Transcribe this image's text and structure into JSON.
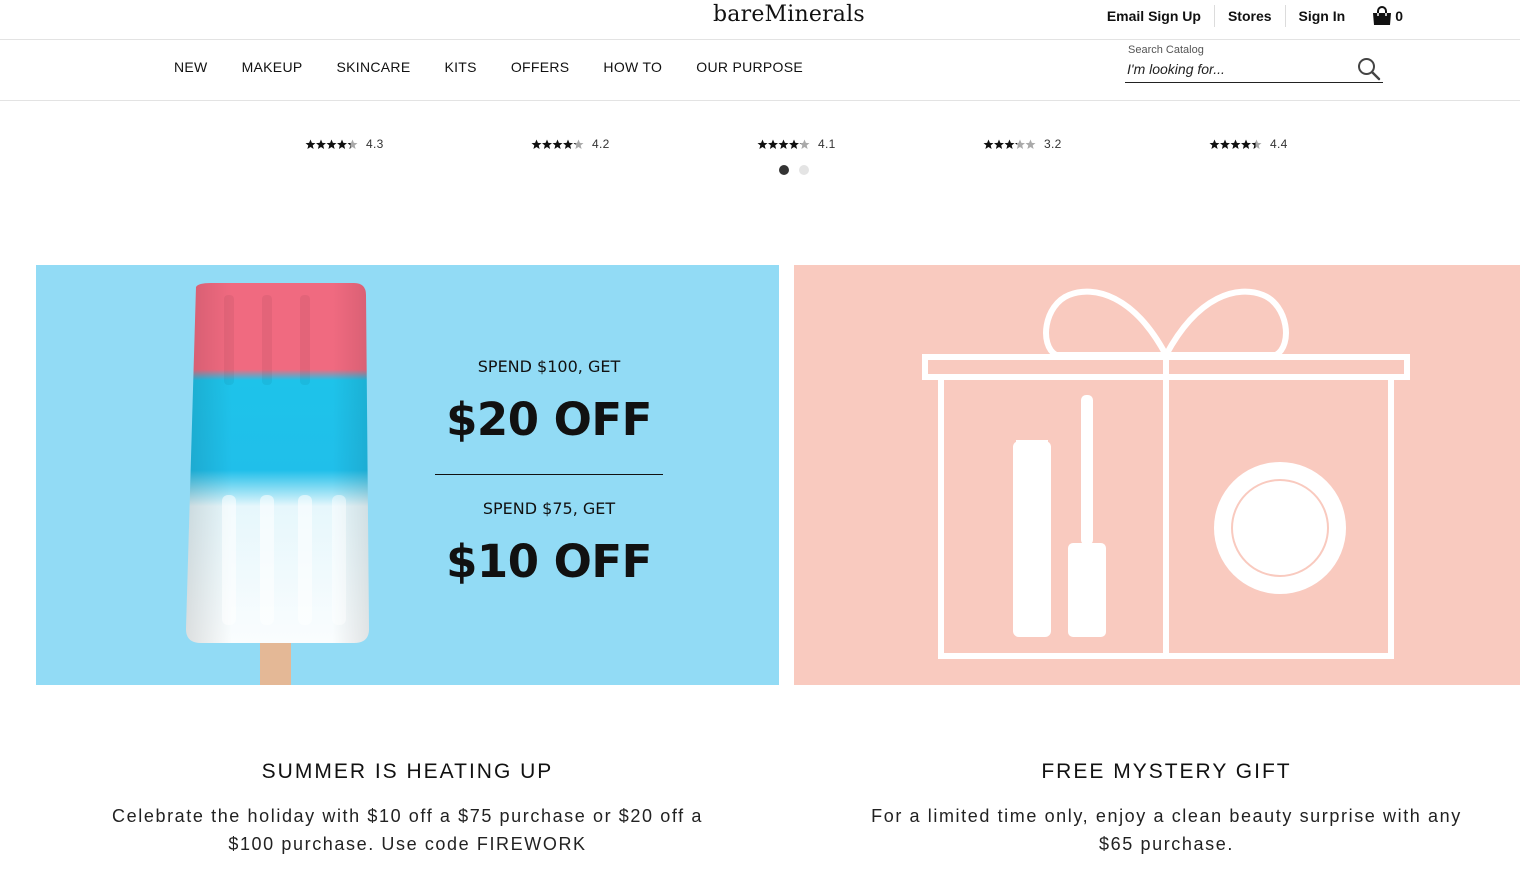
{
  "header": {
    "logo": "bareMinerals",
    "links": [
      "Email Sign Up",
      "Stores",
      "Sign In"
    ],
    "cart_count": "0"
  },
  "nav": {
    "items": [
      "NEW",
      "MAKEUP",
      "SKINCARE",
      "KITS",
      "OFFERS",
      "HOW TO",
      "OUR PURPOSE"
    ]
  },
  "search": {
    "label": "Search Catalog",
    "placeholder": "I'm looking for..."
  },
  "carousel": {
    "ratings": [
      {
        "stars": 4.3,
        "label": "4.3"
      },
      {
        "stars": 4.2,
        "label": "4.2"
      },
      {
        "stars": 4.1,
        "label": "4.1"
      },
      {
        "stars": 3.2,
        "label": "3.2"
      },
      {
        "stars": 4.4,
        "label": "4.4"
      }
    ],
    "pages": 2,
    "active_page": 1
  },
  "promo_left": {
    "line1_small": "SPEND $100, GET",
    "line1_big": "$20 OFF",
    "line2_small": "SPEND $75, GET",
    "line2_big": "$10 OFF",
    "background": "#92dbf5",
    "title": "SUMMER IS HEATING UP",
    "text_line1": "Celebrate the holiday with $10 off a $75 purchase or $20 off a",
    "text_line2": "$100 purchase. Use code FIREWORK"
  },
  "promo_right": {
    "background": "#f9cabf",
    "title": "FREE MYSTERY GIFT",
    "text_line1": "For a limited time only, enjoy a clean beauty surprise with any",
    "text_line2": "$65 purchase."
  }
}
